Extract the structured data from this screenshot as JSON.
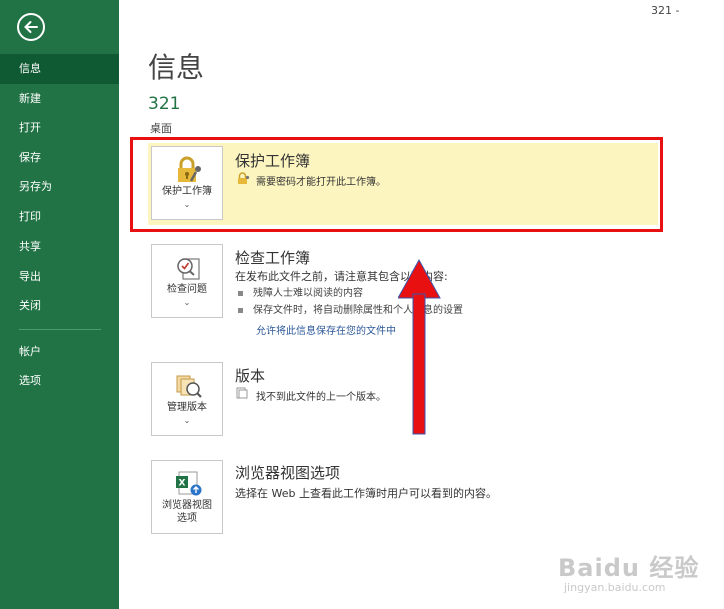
{
  "window": {
    "title": "321 -"
  },
  "sidebar": {
    "items": [
      {
        "label": "信息"
      },
      {
        "label": "新建"
      },
      {
        "label": "打开"
      },
      {
        "label": "保存"
      },
      {
        "label": "另存为"
      },
      {
        "label": "打印"
      },
      {
        "label": "共享"
      },
      {
        "label": "导出"
      },
      {
        "label": "关闭"
      },
      {
        "label": "帐户"
      },
      {
        "label": "选项"
      }
    ]
  },
  "main": {
    "title": "信息",
    "file_name": "321",
    "file_location": "桌面",
    "sections": {
      "protect": {
        "button_label": "保护工作簿",
        "title": "保护工作簿",
        "desc": "需要密码才能打开此工作簿。"
      },
      "inspect": {
        "button_label": "检查问题",
        "title": "检查工作簿",
        "desc": "在发布此文件之前，请注意其包含以下内容:",
        "bullets": [
          "残障人士难以阅读的内容",
          "保存文件时，将自动删除属性和个人信息的设置"
        ],
        "link": "允许将此信息保存在您的文件中"
      },
      "versions": {
        "button_label": "管理版本",
        "title": "版本",
        "desc": "找不到此文件的上一个版本。"
      },
      "browser": {
        "button_label_1": "浏览器视图",
        "button_label_2": "选项",
        "title": "浏览器视图选项",
        "desc": "选择在 Web 上查看此工作簿时用户可以看到的内容。"
      }
    }
  },
  "watermark": {
    "main": "Baidu 经验",
    "sub": "jingyan.baidu.com"
  },
  "colors": {
    "sidebar": "#217346",
    "accent": "#217346",
    "highlight": "#e81010",
    "panel": "#fcf5c0"
  }
}
